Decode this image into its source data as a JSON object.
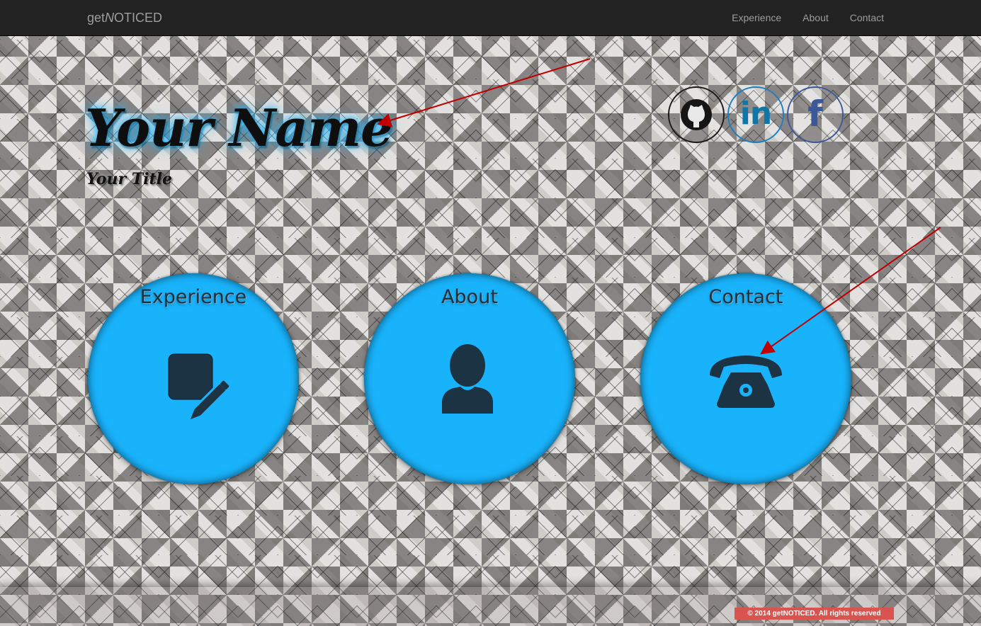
{
  "navbar": {
    "brand_prefix": "get",
    "brand_emphasis": "N",
    "brand_suffix": "OTICED",
    "links": [
      {
        "label": "Experience"
      },
      {
        "label": "About"
      },
      {
        "label": "Contact"
      }
    ],
    "background": "#222222",
    "link_color": "#9d9d9d"
  },
  "hero": {
    "name": "Your Name",
    "title": "Your Title"
  },
  "social": {
    "github": {
      "icon": "github-icon"
    },
    "linkedin": {
      "text": "in",
      "icon": "linkedin-icon"
    },
    "facebook": {
      "text": "f",
      "icon": "facebook-icon"
    }
  },
  "sections": [
    {
      "label": "Experience",
      "icon": "edit-icon"
    },
    {
      "label": "About",
      "icon": "user-icon"
    },
    {
      "label": "Contact",
      "icon": "phone-icon"
    }
  ],
  "colors": {
    "accent": "#19b3fc",
    "icon_dark": "#1c3344",
    "annotation_arrow": "#c00000",
    "copyright_bg": "#d9534f"
  },
  "footer": {
    "copyright": "© 2014 getNOTICED. All rights reserved"
  }
}
